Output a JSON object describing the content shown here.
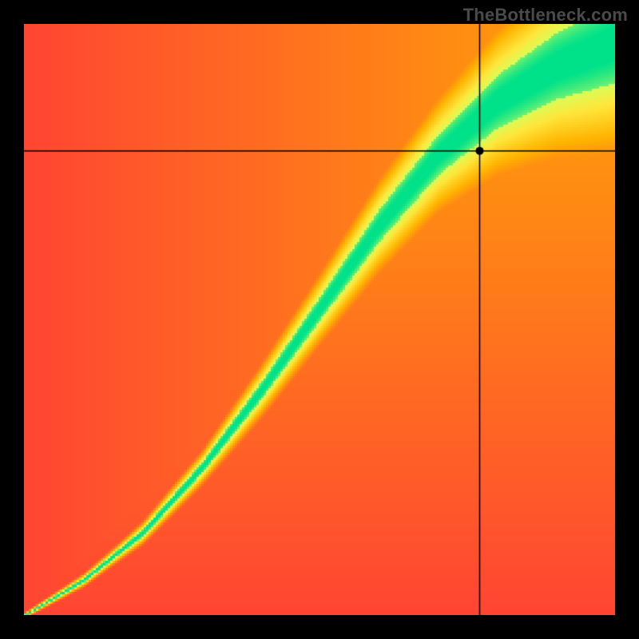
{
  "attribution": "TheBottleneck.com",
  "chart_data": {
    "type": "heatmap",
    "title": "",
    "xlabel": "",
    "ylabel": "",
    "xlim": [
      0,
      1
    ],
    "ylim": [
      0,
      1
    ],
    "crosshair": {
      "x": 0.772,
      "y": 0.785
    },
    "marker": {
      "x": 0.772,
      "y": 0.785,
      "radius": 5,
      "color": "#000"
    },
    "crosshair_color": "#000",
    "color_ramp": [
      {
        "pos": 0.0,
        "color": "#ff2a3f"
      },
      {
        "pos": 0.5,
        "color": "#ffb300"
      },
      {
        "pos": 0.75,
        "color": "#ffe63b"
      },
      {
        "pos": 0.9,
        "color": "#d6ff5a"
      },
      {
        "pos": 1.0,
        "color": "#00e28a"
      }
    ],
    "ridge": {
      "points": [
        {
          "x": 0.0,
          "y": 0.0
        },
        {
          "x": 0.1,
          "y": 0.06
        },
        {
          "x": 0.2,
          "y": 0.14
        },
        {
          "x": 0.3,
          "y": 0.25
        },
        {
          "x": 0.4,
          "y": 0.38
        },
        {
          "x": 0.5,
          "y": 0.52
        },
        {
          "x": 0.6,
          "y": 0.66
        },
        {
          "x": 0.7,
          "y": 0.78
        },
        {
          "x": 0.8,
          "y": 0.87
        },
        {
          "x": 0.9,
          "y": 0.93
        },
        {
          "x": 1.0,
          "y": 0.97
        }
      ],
      "width_profile": [
        {
          "x": 0.0,
          "w": 0.004
        },
        {
          "x": 0.15,
          "w": 0.012
        },
        {
          "x": 0.3,
          "w": 0.025
        },
        {
          "x": 0.5,
          "w": 0.055
        },
        {
          "x": 0.7,
          "w": 0.095
        },
        {
          "x": 0.85,
          "w": 0.14
        },
        {
          "x": 1.0,
          "w": 0.19
        }
      ],
      "softness": 2.0
    },
    "pixelation": 3
  }
}
